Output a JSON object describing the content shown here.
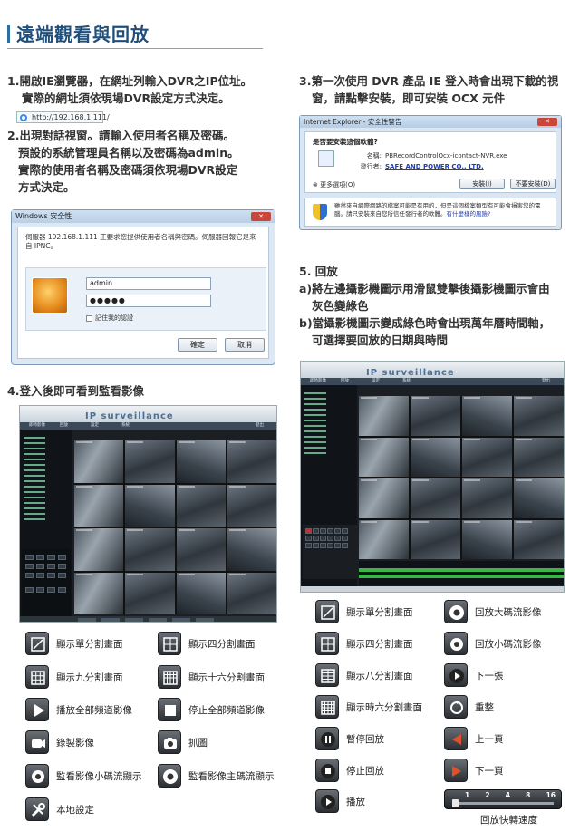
{
  "page": {
    "title": "遠端觀看與回放"
  },
  "steps": {
    "s1": [
      "1.開啟IE瀏覽器，在網址列輸入DVR之IP位址。",
      "實際的網址須依現場DVR設定方式決定。"
    ],
    "s1_url": "http://192.168.1.111/",
    "s2": [
      "2.出現對話視窗。請輸入使用者名稱及密碼。",
      "預設的系統管理員名稱以及密碼為admin。",
      "實際的使用者名稱及密碼須依現場DVR設定",
      "方式決定。"
    ],
    "s3": [
      "3.第一次使用 DVR 產品 IE 登入時會出現下載的視",
      "窗，請點擊安裝，即可安裝 OCX 元件"
    ],
    "s4": [
      "4.登入後即可看到監看影像"
    ],
    "s5": [
      "5. 回放",
      "a)將左邊攝影機圖示用滑鼠雙擊後攝影機圖示會由",
      "灰色變綠色",
      "b)當攝影機圖示變成綠色時會出現萬年曆時間軸，",
      "可選擇要回放的日期與時間"
    ]
  },
  "login_dialog": {
    "title": "Windows 安全性",
    "message": "伺服器 192.168.1.111 正要求您提供使用者名稱與密碼。伺服器回報它是來自 IPNC。",
    "username": "admin",
    "password": "●●●●●",
    "remember": "記住我的認證",
    "ok": "確定",
    "cancel": "取消"
  },
  "ie_warning": {
    "title": "Internet Explorer - 安全性警告",
    "question": "是否要安裝這個軟體?",
    "name_label": "名稱:",
    "name_value": "PBRecordControlOcx-icontact-NVR.exe",
    "publisher_label": "發行者:",
    "publisher_value": "SAFE AND POWER CO., LTD.",
    "more": "更多選項(O)",
    "install": "安裝(I)",
    "dont_install": "不要安裝(D)",
    "note": "雖然來自網際網路的檔案可能是有用的，但是這個檔案類型有可能會損害您的電腦。請只安裝來自您所信任發行者的軟體。",
    "note_link": "有什麼樣的風險?"
  },
  "surveillance": {
    "brand": "IP surveillance",
    "menu": [
      "即時影像",
      "回放",
      "設定",
      "系統",
      "登出"
    ]
  },
  "legend_left": [
    {
      "icon": "single-split-icon",
      "label": "顯示單分割畫面"
    },
    {
      "icon": "quad-split-icon",
      "label": "顯示四分割畫面"
    },
    {
      "icon": "nine-split-icon",
      "label": "顯示九分割畫面"
    },
    {
      "icon": "sixteen-split-icon",
      "label": "顯示十六分割畫面"
    },
    {
      "icon": "play-all-icon",
      "label": "播放全部頻道影像"
    },
    {
      "icon": "stop-all-icon",
      "label": "停止全部頻道影像"
    },
    {
      "icon": "record-icon",
      "label": "錄製影像"
    },
    {
      "icon": "snapshot-icon",
      "label": "抓圖"
    },
    {
      "icon": "substream-icon",
      "label": "監看影像小碼流顯示"
    },
    {
      "icon": "mainstream-icon",
      "label": "監看影像主碼流顯示"
    },
    {
      "icon": "local-settings-icon",
      "label": "本地設定"
    }
  ],
  "legend_right": [
    {
      "icon": "single-split-icon",
      "label": "顯示單分割畫面"
    },
    {
      "icon": "playback-mainstream-icon",
      "label": "回放大碼流影像"
    },
    {
      "icon": "quad-split-icon",
      "label": "顯示四分割畫面"
    },
    {
      "icon": "playback-substream-icon",
      "label": "回放小碼流影像"
    },
    {
      "icon": "eight-split-icon",
      "label": "顯示八分割畫面"
    },
    {
      "icon": "next-frame-icon",
      "label": "下一張"
    },
    {
      "icon": "sixteen-split-icon",
      "label": "顯示時六分割畫面"
    },
    {
      "icon": "reset-icon",
      "label": "重整"
    },
    {
      "icon": "pause-icon",
      "label": "暫停回放"
    },
    {
      "icon": "prev-page-icon",
      "label": "上一頁"
    },
    {
      "icon": "stop-playback-icon",
      "label": "停止回放"
    },
    {
      "icon": "next-page-icon",
      "label": "下一頁"
    },
    {
      "icon": "play-icon",
      "label": "播放"
    }
  ],
  "speed": {
    "values": [
      "1",
      "2",
      "4",
      "8",
      "16"
    ],
    "label": "回放快轉速度"
  }
}
